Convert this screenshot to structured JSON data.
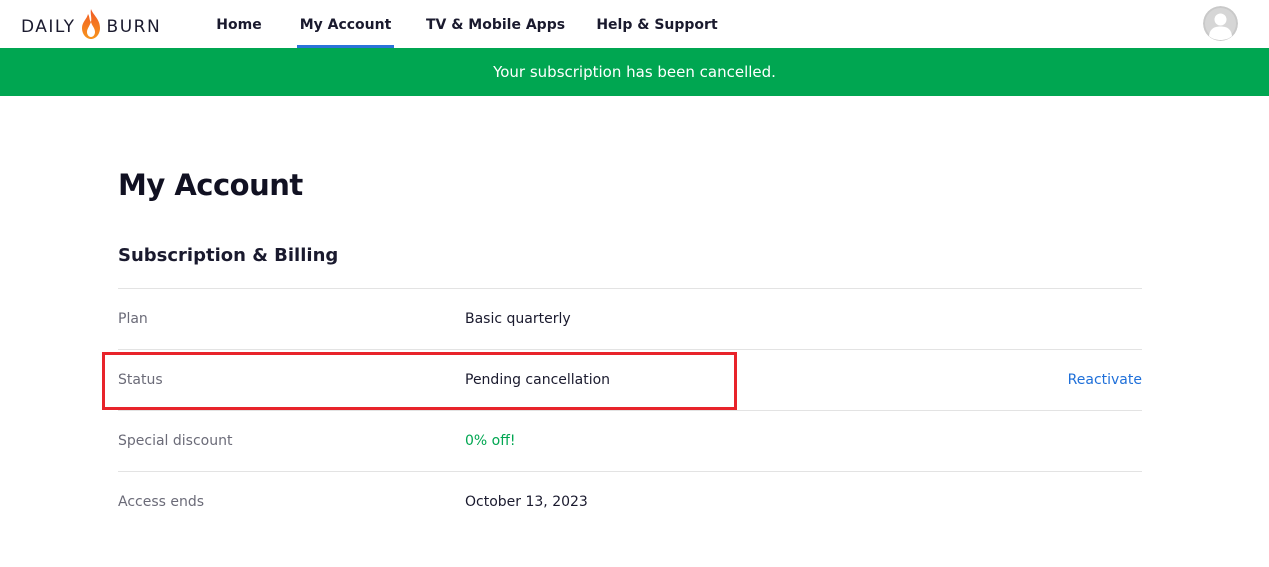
{
  "header": {
    "logo": {
      "left_word": "DAILY",
      "right_word": "BURN"
    },
    "nav": [
      {
        "label": "Home"
      },
      {
        "label": "My Account",
        "active": true
      },
      {
        "label": "TV & Mobile Apps"
      },
      {
        "label": "Help & Support"
      }
    ],
    "avatar_icon": "user-avatar-icon"
  },
  "banner": {
    "message": "Your subscription has been cancelled."
  },
  "main": {
    "title": "My Account",
    "section_title": "Subscription & Billing",
    "rows": [
      {
        "label": "Plan",
        "value": "Basic quarterly"
      },
      {
        "label": "Status",
        "value": "Pending cancellation",
        "action": "Reactivate"
      },
      {
        "label": "Special discount",
        "value": "0% off!"
      },
      {
        "label": "Access ends",
        "value": "October 13, 2023"
      }
    ]
  },
  "colors": {
    "banner_green": "#00a651",
    "link_blue": "#1e6fd9",
    "discount_green": "#00a651",
    "highlight_red": "#e8232a",
    "nav_active_underline": "#2a73d9"
  }
}
